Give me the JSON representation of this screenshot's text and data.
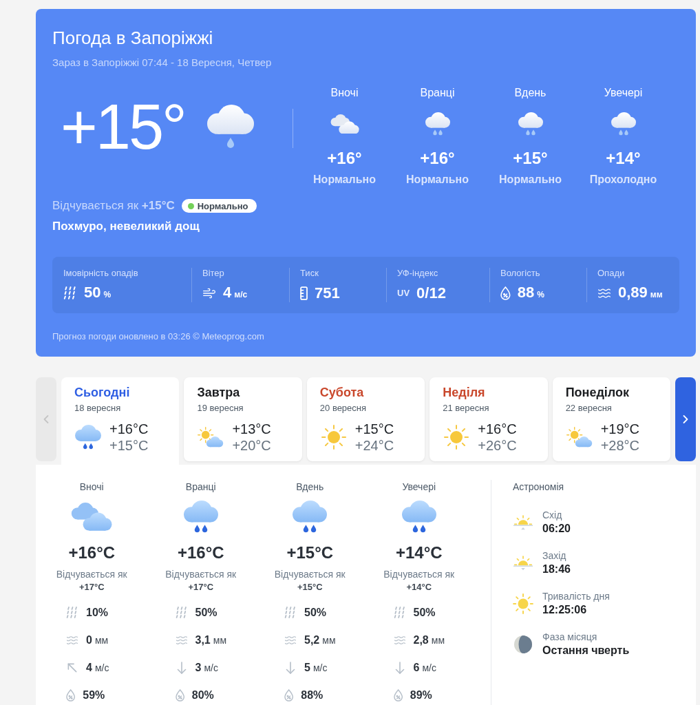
{
  "header": {
    "title": "Погода в Запоріжжі",
    "subtitle": "Зараз в Запоріжжі 07:44 - 18 Вересня, Четвер"
  },
  "current": {
    "temperature": "+15°",
    "kind": "light_rain",
    "feels_like": "Відчувається як **+15°C**",
    "comfort": {
      "label": "Нормально",
      "color": "#74d159"
    },
    "condition": "Похмуро, невеликий дощ"
  },
  "periods": [
    {
      "label": "Вночі",
      "kind": "cloudy",
      "temperature": "+16°",
      "description": "Нормально"
    },
    {
      "label": "Вранці",
      "kind": "rain",
      "temperature": "+16°",
      "description": "Нормально"
    },
    {
      "label": "Вдень",
      "kind": "rain",
      "temperature": "+15°",
      "description": "Нормально"
    },
    {
      "label": "Увечері",
      "kind": "rain",
      "temperature": "+14°",
      "description": "Прохолодно"
    }
  ],
  "stats": [
    {
      "kind": "chance",
      "label": "Імовірність опадів",
      "value": "50",
      "unit": "%"
    },
    {
      "kind": "wind",
      "label": "Вітер",
      "value": "4",
      "unit": "м/с"
    },
    {
      "kind": "pressure",
      "label": "Тиск",
      "value": "751"
    },
    {
      "kind": "uv",
      "label": "УФ-індекс",
      "badge": "UV",
      "value": "0/12"
    },
    {
      "kind": "humidity",
      "label": "Вологість",
      "value": "88",
      "unit": "%"
    },
    {
      "kind": "amount",
      "label": "Опади",
      "value": "0,89",
      "unit": "мм"
    }
  ],
  "update_note": "Прогноз погоди оновлено в 03:26 © Meteoprog.com",
  "day_nav": {
    "previous": {
      "disabled": true
    },
    "next": {
      "disabled": false
    }
  },
  "days": [
    {
      "name": "Сьогодні",
      "color": "#2f5fe3",
      "date": "18 вересня",
      "kind": "rain",
      "temps": [
        "+16°C",
        "+15°C"
      ],
      "selected": true
    },
    {
      "name": "Завтра",
      "color": "#1b1d20",
      "date": "19 вересня",
      "kind": "partly_cloudy",
      "temps": [
        "+13°C",
        "+20°C"
      ],
      "selected": false
    },
    {
      "name": "Субота",
      "color": "#c9472b",
      "date": "20 вересня",
      "kind": "sunny",
      "temps": [
        "+15°C",
        "+24°C"
      ],
      "selected": false
    },
    {
      "name": "Неділя",
      "color": "#c9472b",
      "date": "21 вересня",
      "kind": "sunny",
      "temps": [
        "+16°C",
        "+26°C"
      ],
      "selected": false
    },
    {
      "name": "Понеділок",
      "color": "#1b1d20",
      "date": "22 вересня",
      "kind": "partly_cloudy",
      "temps": [
        "+19°C",
        "+28°C"
      ],
      "selected": false
    }
  ],
  "detail": {
    "periods": [
      {
        "label": "Вночі",
        "kind": "cloudy",
        "temperature": "+16°C",
        "feels_label": "Відчувається як",
        "feels_value": "+17°C",
        "stats": [
          {
            "kind": "chance",
            "value": "10%"
          },
          {
            "kind": "amount",
            "value": "0",
            "unit": "мм"
          },
          {
            "kind": "wind_nw",
            "value": "4",
            "unit": "м/с"
          },
          {
            "kind": "humidity",
            "value": "59%"
          }
        ]
      },
      {
        "label": "Вранці",
        "kind": "rain",
        "temperature": "+16°C",
        "feels_label": "Відчувається як",
        "feels_value": "+17°C",
        "stats": [
          {
            "kind": "chance",
            "value": "50%"
          },
          {
            "kind": "amount",
            "value": "3,1",
            "unit": "мм"
          },
          {
            "kind": "wind_s",
            "value": "3",
            "unit": "м/с"
          },
          {
            "kind": "humidity",
            "value": "80%"
          }
        ]
      },
      {
        "label": "Вдень",
        "kind": "rain",
        "temperature": "+15°C",
        "feels_label": "Відчувається як",
        "feels_value": "+15°C",
        "stats": [
          {
            "kind": "chance",
            "value": "50%"
          },
          {
            "kind": "amount",
            "value": "5,2",
            "unit": "мм"
          },
          {
            "kind": "wind_s",
            "value": "5",
            "unit": "м/с"
          },
          {
            "kind": "humidity",
            "value": "88%"
          }
        ]
      },
      {
        "label": "Увечері",
        "kind": "rain",
        "temperature": "+14°C",
        "feels_label": "Відчувається як",
        "feels_value": "+14°C",
        "stats": [
          {
            "kind": "chance",
            "value": "50%"
          },
          {
            "kind": "amount",
            "value": "2,8",
            "unit": "мм"
          },
          {
            "kind": "wind_s",
            "value": "6",
            "unit": "м/с"
          },
          {
            "kind": "humidity",
            "value": "89%"
          }
        ]
      }
    ],
    "astronomy": {
      "title": "Астрономія",
      "items": [
        {
          "kind": "sunrise",
          "label": "Схід",
          "value": "06:20"
        },
        {
          "kind": "sunset",
          "label": "Захід",
          "value": "18:46"
        },
        {
          "kind": "day_length",
          "label": "Тривалість дня",
          "value": "12:25:06"
        },
        {
          "kind": "moon",
          "label": "Фаза місяця",
          "value": "Остання чверть"
        }
      ]
    }
  }
}
